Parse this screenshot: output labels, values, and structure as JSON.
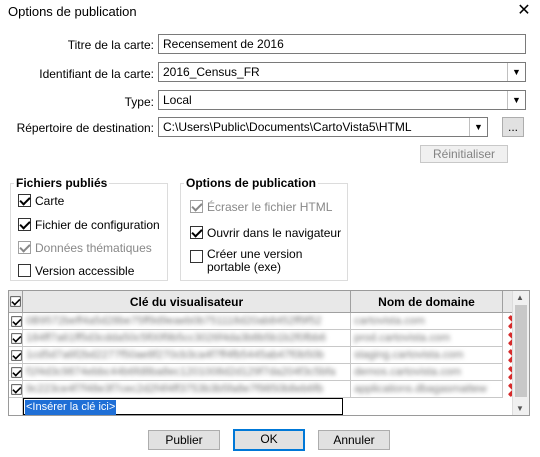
{
  "window": {
    "title": "Options de publication",
    "close": "✕"
  },
  "form": {
    "map_title_label": "Titre de la carte:",
    "map_title_value": "Recensement de 2016",
    "map_id_label": "Identifiant de la carte:",
    "map_id_value": "2016_Census_FR",
    "type_label": "Type:",
    "type_value": "Local",
    "dest_label": "Répertoire de destination:",
    "dest_value": "C:\\Users\\Public\\Documents\\CartoVista5\\HTML",
    "browse_label": "...",
    "reset_label": "Réinitialiser"
  },
  "files_group": {
    "title": "Fichiers publiés",
    "items": [
      {
        "label": "Carte",
        "checked": true,
        "disabled": false
      },
      {
        "label": "Fichier de configuration",
        "checked": true,
        "disabled": false
      },
      {
        "label": "Données thématiques",
        "checked": true,
        "disabled": true
      },
      {
        "label": "Version accessible",
        "checked": false,
        "disabled": false
      }
    ]
  },
  "options_group": {
    "title": "Options de publication",
    "items": [
      {
        "label": "Écraser le fichier HTML",
        "checked": true,
        "disabled": true
      },
      {
        "label": "Ouvrir dans le navigateur",
        "checked": true,
        "disabled": false
      },
      {
        "label": "Créer une version portable (exe)",
        "checked": false,
        "disabled": false
      }
    ]
  },
  "grid": {
    "col_key": "Clé du visualisateur",
    "col_domain": "Nom de domaine",
    "rows": [
      {
        "key": "0B9572beff4a5d28be75ff9d9eaeb0b751118d20ab8452ff9f52",
        "domain": "cartovista.com"
      },
      {
        "key": "184ff7a61ff5d3cdda50c5f00f9b5cc3026f4da3b8b5b1b2f0fbb6",
        "domain": "prod.cartovista.com"
      },
      {
        "key": "1cd5d7a6f2bd2277f50ae8f270cb3ca4f7ff4fb5445ab47f0b50b",
        "domain": "staging.cartovista.com"
      },
      {
        "key": "f1f4d3c9874ebbc44b6fd8ba8ec1201008d2d129f7da204f3c5bfa",
        "domain": "demos.cartovista.com"
      },
      {
        "key": "9c223ce4f7f48e3f7cec2d2f4f4ff3753b3b5fa8e7f9850b8eb6fb",
        "domain": "applications.dbagasmattew"
      }
    ],
    "insert_placeholder": "<Insérer la clé ici>"
  },
  "buttons": {
    "publish": "Publier",
    "ok": "OK",
    "cancel": "Annuler"
  },
  "colors": {
    "accent": "#0078d7",
    "delete": "#d62b2b",
    "selection": "#1f6fd6"
  }
}
